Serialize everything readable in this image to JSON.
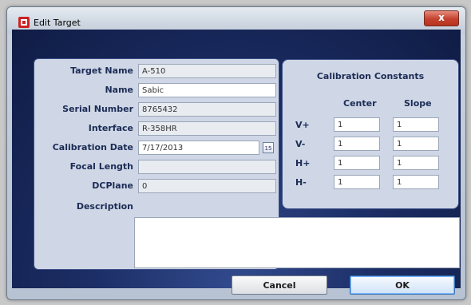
{
  "window": {
    "title": "Edit Target",
    "close_glyph": "x"
  },
  "form": {
    "fields": [
      {
        "label": "Target Name",
        "value": "A-510"
      },
      {
        "label": "Name",
        "value": "Sabic"
      },
      {
        "label": "Serial Number",
        "value": "8765432"
      },
      {
        "label": "Interface",
        "value": "R-358HR"
      },
      {
        "label": "Calibration Date",
        "value": "7/17/2013"
      },
      {
        "label": "Focal Length",
        "value": ""
      },
      {
        "label": "DCPlane",
        "value": "0"
      }
    ],
    "description_label": "Description",
    "description_value": "",
    "calendar_icon_text": "15"
  },
  "calibration": {
    "title": "Calibration Constants",
    "center_header": "Center",
    "slope_header": "Slope",
    "rows": [
      {
        "label": "V+",
        "center": "1",
        "slope": "1"
      },
      {
        "label": "V-",
        "center": "1",
        "slope": "1"
      },
      {
        "label": "H+",
        "center": "1",
        "slope": "1"
      },
      {
        "label": "H-",
        "center": "1",
        "slope": "1"
      }
    ]
  },
  "buttons": {
    "cancel": "Cancel",
    "ok": "OK"
  },
  "icons": {
    "app": "target-app-icon",
    "calendar": "calendar-icon",
    "close": "close-icon"
  },
  "colors": {
    "client_bg": "#16275a",
    "panel_bg": "#cfd7e6",
    "close_btn": "#c4412d"
  }
}
